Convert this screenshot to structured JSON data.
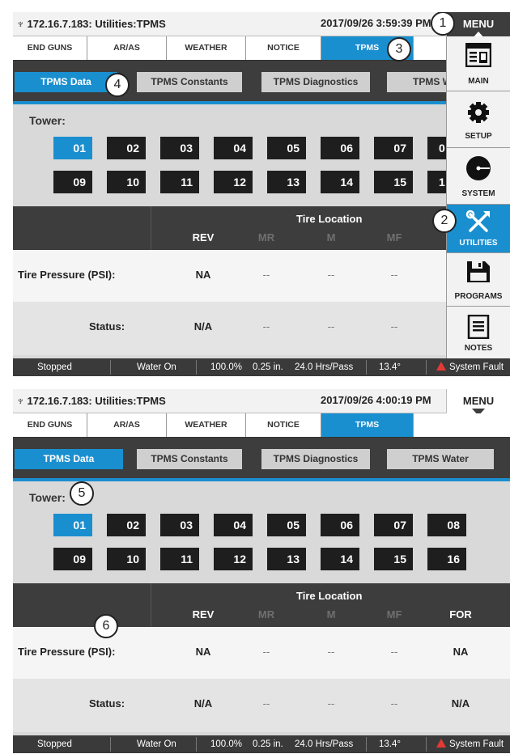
{
  "screens": [
    {
      "title": "172.16.7.183: Utilities:TPMS",
      "datetime": "2017/09/26 3:59:39 PM",
      "menu_label": "MENU",
      "menu_open": true
    },
    {
      "title": "172.16.7.183: Utilities:TPMS",
      "datetime": "2017/09/26 4:00:19 PM",
      "menu_label": "MENU",
      "menu_open": false
    }
  ],
  "top_nav": [
    "END GUNS",
    "AR/AS",
    "WEATHER",
    "NOTICE",
    "TPMS"
  ],
  "top_nav_active": "TPMS",
  "sub_tabs": [
    "TPMS Data",
    "TPMS Constants",
    "TPMS Diagnostics",
    "TPMS Water"
  ],
  "sub_tabs_truncated_s1": "TPMS W",
  "tower_label": "Tower:",
  "towers": [
    "01",
    "02",
    "03",
    "04",
    "05",
    "06",
    "07",
    "08",
    "09",
    "10",
    "11",
    "12",
    "13",
    "14",
    "15",
    "16"
  ],
  "tower_partial_s1": [
    "0",
    "1"
  ],
  "selected_tower": "01",
  "table": {
    "location_title": "Tire Location",
    "columns": [
      "REV",
      "MR",
      "M",
      "MF",
      "FOR"
    ],
    "rows": [
      {
        "label": "Tire Pressure (PSI):",
        "values": [
          "NA",
          "--",
          "--",
          "--",
          "NA"
        ]
      },
      {
        "label": "Status:",
        "values": [
          "N/A",
          "--",
          "--",
          "--",
          "N/A"
        ]
      }
    ]
  },
  "status_bar": {
    "state": "Stopped",
    "water": "Water On",
    "percent": "100.0%",
    "depth": "0.25 in.",
    "hours": "24.0 Hrs/Pass",
    "angle": "13.4°",
    "fault": "System Fault"
  },
  "side_menu": [
    "MAIN",
    "SETUP",
    "SYSTEM",
    "UTILITIES",
    "PROGRAMS",
    "NOTES"
  ],
  "side_menu_active": "UTILITIES",
  "callouts": [
    "1",
    "2",
    "3",
    "4",
    "5",
    "6"
  ],
  "colors": {
    "accent": "#1a8fd0",
    "dark": "#3d3d3d",
    "fault": "#e53935"
  }
}
